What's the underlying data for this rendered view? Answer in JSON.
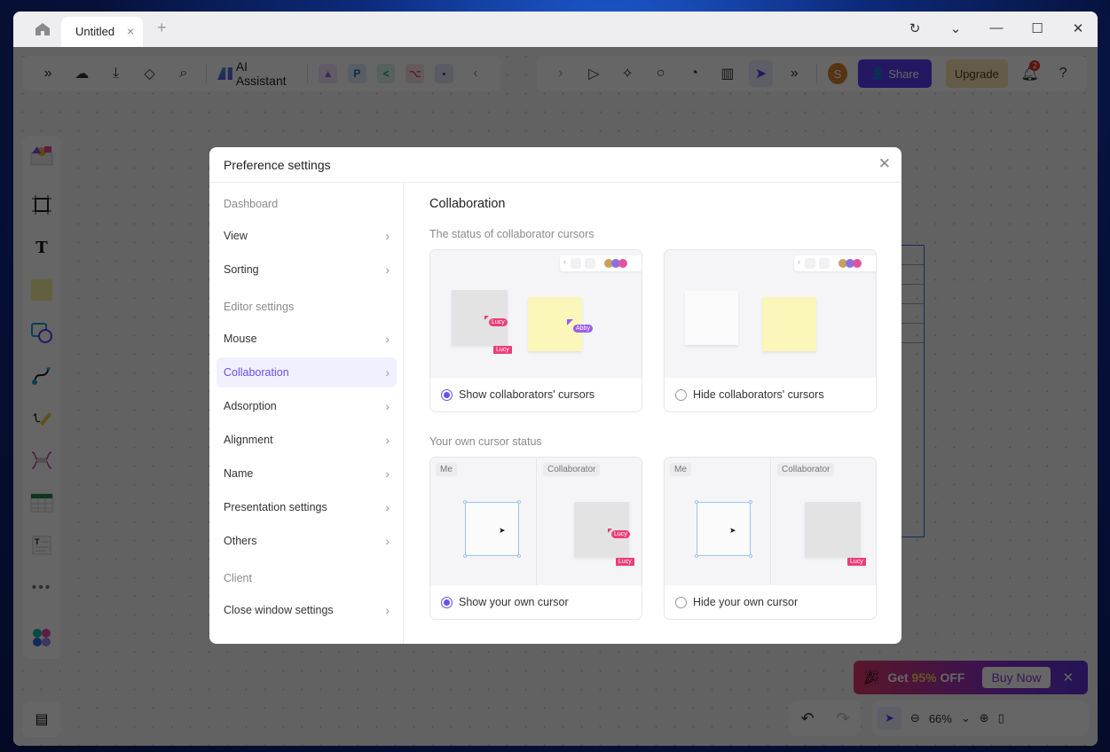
{
  "window": {
    "tab_title": "Untitled",
    "new_tab": "+",
    "tab_close": "×",
    "controls": {
      "refresh": "↻",
      "dropdown": "⌄",
      "minimize": "—",
      "maximize": "☐",
      "close": "✕"
    }
  },
  "toolbar_left": {
    "ai_assistant_label": "AI Assistant"
  },
  "toolbar_right": {
    "avatar_initial": "S",
    "share_label": "Share",
    "upgrade_label": "Upgrade",
    "notification_count": "2"
  },
  "promo": {
    "text_prefix": "Get ",
    "percent": "95%",
    "text_suffix": " OFF",
    "buy_label": "Buy Now"
  },
  "zoom": {
    "level": "66%"
  },
  "dialog": {
    "title": "Preference settings",
    "nav": {
      "groups": [
        "Dashboard",
        "Editor settings",
        "Client"
      ],
      "items": [
        {
          "label": "View"
        },
        {
          "label": "Sorting"
        },
        {
          "label": "Mouse"
        },
        {
          "label": "Collaboration",
          "active": true
        },
        {
          "label": "Adsorption"
        },
        {
          "label": "Alignment"
        },
        {
          "label": "Name"
        },
        {
          "label": "Presentation settings"
        },
        {
          "label": "Others"
        },
        {
          "label": "Close window settings"
        }
      ]
    },
    "content": {
      "title": "Collaboration",
      "collab_cursors": {
        "subtitle": "The status of collaborator cursors",
        "options": [
          {
            "label": "Show collaborators' cursors",
            "checked": true
          },
          {
            "label": "Hide collaborators' cursors",
            "checked": false
          }
        ],
        "preview_names": [
          "Lucy",
          "Abby"
        ]
      },
      "own_cursor": {
        "subtitle": "Your own cursor status",
        "options": [
          {
            "label": "Show your own cursor",
            "checked": true
          },
          {
            "label": "Hide your own cursor",
            "checked": false
          }
        ],
        "pane_labels": [
          "Me",
          "Collaborator"
        ],
        "preview_name": "Lucy"
      }
    }
  },
  "colors": {
    "accent": "#6a4ef5",
    "share": "#5b3df5",
    "upgrade_bg": "#fbe4b6",
    "cursor_pink": "#ec3d7a",
    "cursor_purple": "#9b5cf0",
    "sticky_yellow": "#fbf6b9"
  }
}
